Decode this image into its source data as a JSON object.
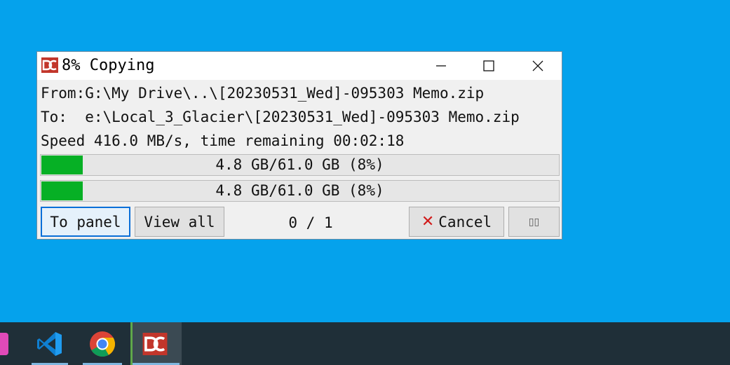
{
  "window": {
    "title": "8% Copying",
    "icon": "double-commander-icon",
    "controls": [
      "minimize-icon",
      "maximize-icon",
      "close-icon"
    ]
  },
  "info": {
    "from": "From:G:\\My Drive\\..\\[20230531_Wed]-095303 Memo.zip",
    "to": "To:  e:\\Local_3_Glacier\\[20230531_Wed]-095303 Memo.zip",
    "speed": "Speed 416.0 MB/s, time remaining 00:02:18"
  },
  "progress": [
    {
      "text": "4.8 GB/61.0 GB (8%)",
      "fraction": 0.08
    },
    {
      "text": "4.8 GB/61.0 GB (8%)",
      "fraction": 0.08
    }
  ],
  "buttons": {
    "to_panel": "To panel",
    "view_all": "View all",
    "cancel": "Cancel",
    "pause": "▯▯"
  },
  "counter": "0 / 1",
  "colors": {
    "desktop": "#05a2ec",
    "progress_fill": "#06b025",
    "cancel_x": "#d11a1a",
    "focus_border": "#0a6fd8"
  },
  "taskbar": {
    "items": [
      "app-icon",
      "vscode-icon",
      "chrome-icon",
      "double-commander-icon"
    ]
  }
}
